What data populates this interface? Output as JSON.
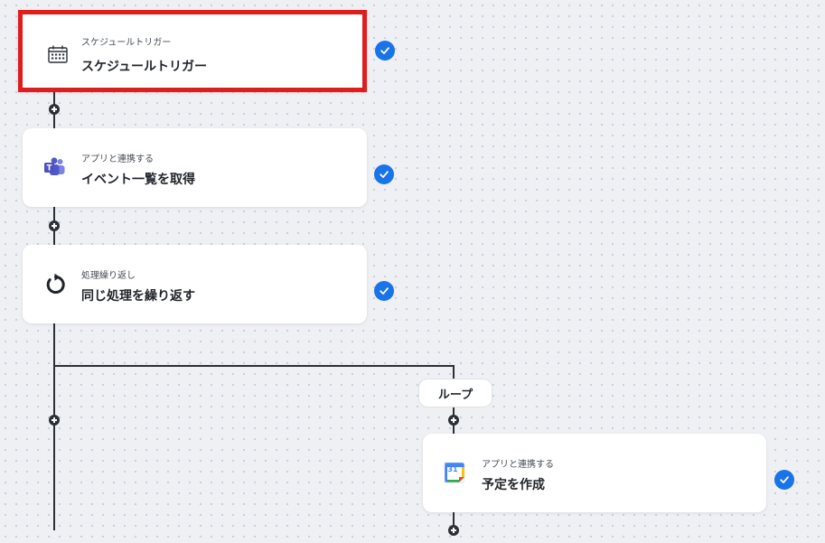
{
  "flow": {
    "steps": [
      {
        "subtitle": "スケジュールトリガー",
        "title": "スケジュールトリガー",
        "icon": "calendar-clock-icon",
        "status_icon": "check-icon",
        "selected": true
      },
      {
        "subtitle": "アプリと連携する",
        "title": "イベント一覧を取得",
        "icon": "microsoft-teams-icon",
        "status_icon": "check-icon"
      },
      {
        "subtitle": "処理繰り返し",
        "title": "同じ処理を繰り返す",
        "icon": "loop-arrow-icon",
        "status_icon": "check-icon"
      }
    ],
    "loop_branch": {
      "label": "ループ",
      "steps": [
        {
          "subtitle": "アプリと連携する",
          "title": "予定を作成",
          "icon": "google-calendar-icon",
          "icon_text": "31",
          "status_icon": "check-icon"
        }
      ]
    }
  },
  "colors": {
    "canvas": "#eef0f4",
    "connector": "#2b2f36",
    "check": "#1a73e8",
    "selection_border": "#e01d1d"
  }
}
